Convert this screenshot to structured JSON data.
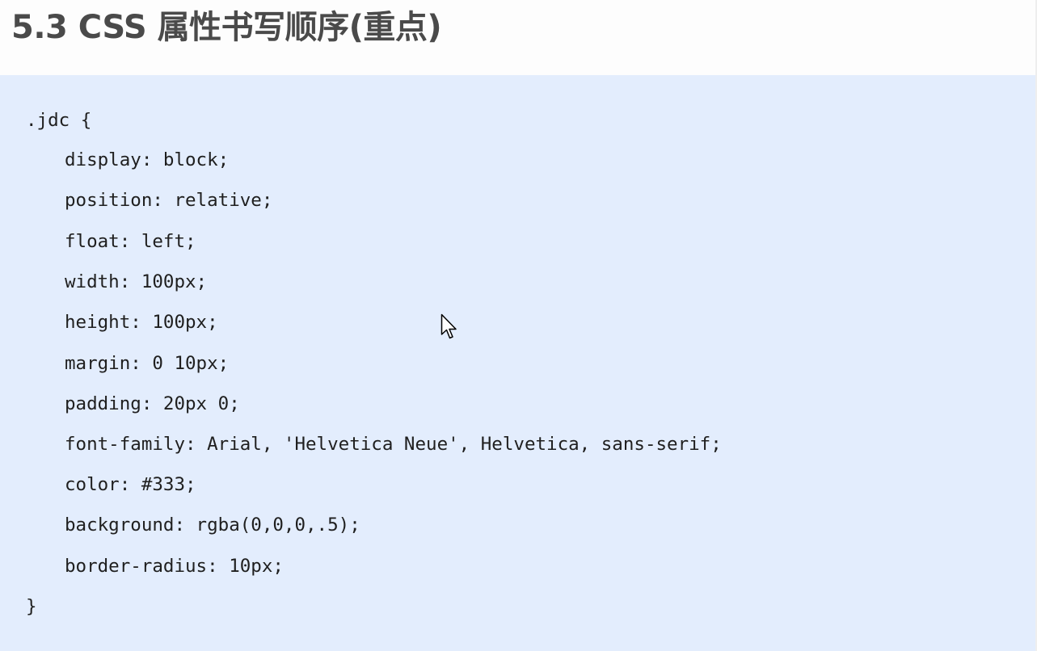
{
  "page": {
    "title": "5.3 CSS 属性书写顺序(重点)"
  },
  "code": {
    "selector_open": ".jdc {",
    "declarations": [
      "display: block;",
      "position: relative;",
      "float: left;",
      "width: 100px;",
      "height: 100px;",
      "margin: 0 10px;",
      "padding: 20px 0;",
      "font-family: Arial, 'Helvetica Neue', Helvetica, sans-serif;",
      "color: #333;",
      "background: rgba(0,0,0,.5);",
      "border-radius: 10px;"
    ],
    "closing_brace": "}"
  },
  "colors": {
    "code_background": "#e3edfd",
    "title_text": "#4a4a4a",
    "code_text": "#1f1f1f"
  },
  "icons": {
    "cursor": "mouse-pointer-icon"
  }
}
